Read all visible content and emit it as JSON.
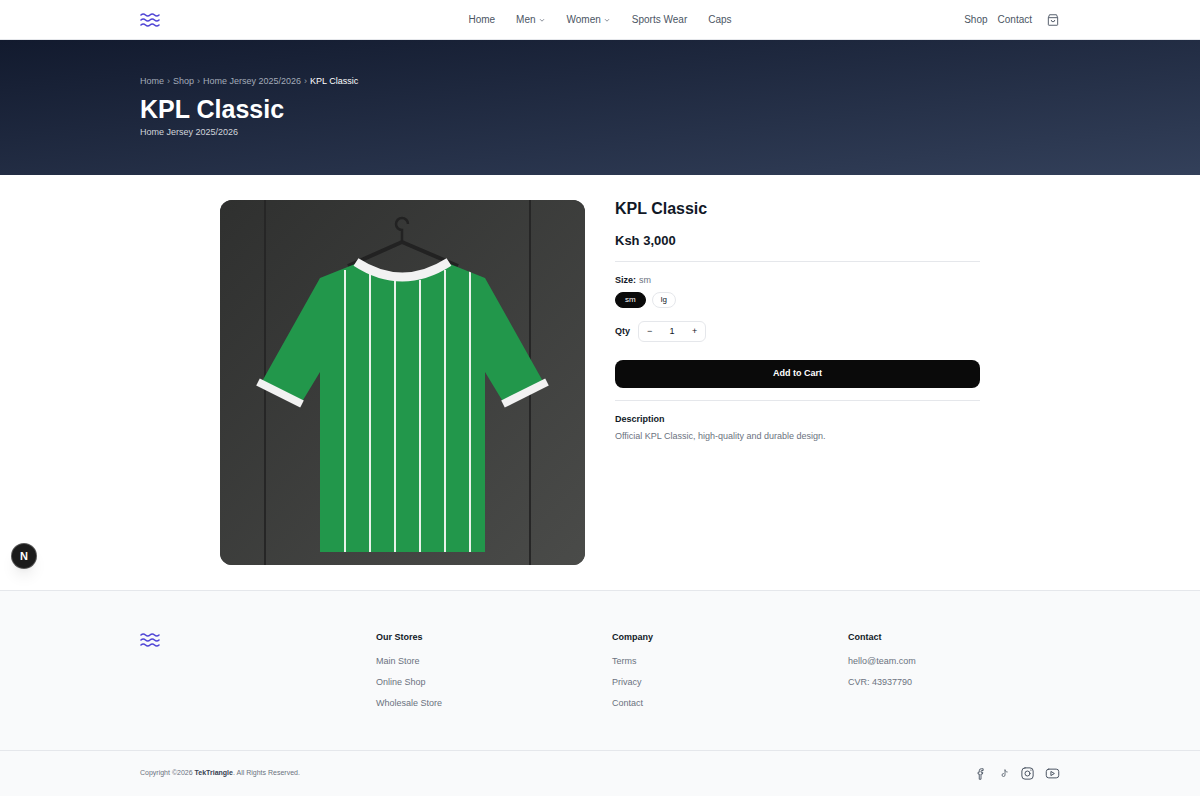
{
  "nav": {
    "links": [
      {
        "label": "Home",
        "dropdown": false
      },
      {
        "label": "Men",
        "dropdown": true
      },
      {
        "label": "Women",
        "dropdown": true
      },
      {
        "label": "Sports Wear",
        "dropdown": false
      },
      {
        "label": "Caps",
        "dropdown": false
      }
    ],
    "right": [
      "Shop",
      "Contact"
    ]
  },
  "hero": {
    "breadcrumb": [
      {
        "label": "Home",
        "current": false
      },
      {
        "label": "Shop",
        "current": false
      },
      {
        "label": "Home Jersey 2025/2026",
        "current": false
      },
      {
        "label": "KPL Classic",
        "current": true
      }
    ],
    "separator": "›",
    "title": "KPL Classic",
    "subtitle": "Home Jersey 2025/2026"
  },
  "product": {
    "title": "KPL Classic",
    "price": "Ksh 3,000",
    "size_label": "Size:",
    "size_value": "sm",
    "sizes": [
      {
        "label": "sm",
        "selected": true
      },
      {
        "label": "lg",
        "selected": false
      }
    ],
    "qty_label": "Qty",
    "qty_minus": "−",
    "qty_value": "1",
    "qty_plus": "+",
    "add_button": "Add to Cart",
    "description_heading": "Description",
    "description": "Official KPL Classic, high-quality and durable design."
  },
  "footer": {
    "columns": [
      {
        "heading": "Our Stores",
        "items": [
          "Main Store",
          "Online Shop",
          "Wholesale Store"
        ]
      },
      {
        "heading": "Company",
        "items": [
          "Terms",
          "Privacy",
          "Contact"
        ]
      },
      {
        "heading": "Contact",
        "items": [
          "hello@team.com",
          "CVR: 43937790"
        ]
      }
    ],
    "copyright": {
      "before": "Copyright ©2026 ",
      "brand": "TekTriangle",
      "after": ". All Rights Reserved."
    }
  },
  "dev_indicator": "N"
}
